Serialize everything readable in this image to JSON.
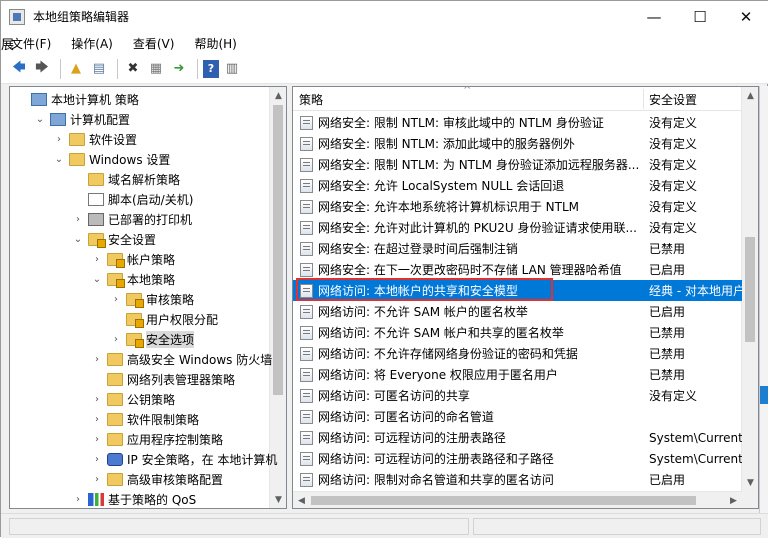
{
  "window": {
    "title": "本地组策略编辑器",
    "controls": {
      "minimize": "—",
      "maximize": "☐",
      "close": "✕"
    },
    "partial_glyph": "展"
  },
  "menu": [
    "文件(F)",
    "操作(A)",
    "查看(V)",
    "帮助(H)"
  ],
  "toolbar": [
    {
      "name": "back-icon",
      "glyph": "🡄"
    },
    {
      "name": "forward-icon",
      "glyph": "🡆"
    },
    {
      "name": "up-folder-icon",
      "glyph": "▲"
    },
    {
      "name": "show-tree-icon",
      "glyph": "▤"
    },
    {
      "name": "delete-icon",
      "glyph": "✖"
    },
    {
      "name": "properties-icon",
      "glyph": "▦"
    },
    {
      "name": "export-icon",
      "glyph": "➜"
    },
    {
      "name": "help-icon",
      "glyph": "?"
    },
    {
      "name": "view-icon",
      "glyph": "▥"
    }
  ],
  "tree": [
    {
      "label": "本地计算机 策略",
      "depth": 0,
      "twisty": "",
      "icon": "computer"
    },
    {
      "label": "计算机配置",
      "depth": 1,
      "twisty": "⌄",
      "icon": "computer"
    },
    {
      "label": "软件设置",
      "depth": 2,
      "twisty": "›",
      "icon": "folder"
    },
    {
      "label": "Windows 设置",
      "depth": 2,
      "twisty": "⌄",
      "icon": "folder"
    },
    {
      "label": "域名解析策略",
      "depth": 3,
      "twisty": "",
      "icon": "folder"
    },
    {
      "label": "脚本(启动/关机)",
      "depth": 3,
      "twisty": "",
      "icon": "doc"
    },
    {
      "label": "已部署的打印机",
      "depth": 3,
      "twisty": "›",
      "icon": "printer"
    },
    {
      "label": "安全设置",
      "depth": 3,
      "twisty": "⌄",
      "icon": "folder-locked"
    },
    {
      "label": "帐户策略",
      "depth": 4,
      "twisty": "›",
      "icon": "folder-locked"
    },
    {
      "label": "本地策略",
      "depth": 4,
      "twisty": "⌄",
      "icon": "folder-locked"
    },
    {
      "label": "审核策略",
      "depth": 5,
      "twisty": "›",
      "icon": "folder-locked"
    },
    {
      "label": "用户权限分配",
      "depth": 5,
      "twisty": "",
      "icon": "folder-locked"
    },
    {
      "label": "安全选项",
      "depth": 5,
      "twisty": "›",
      "icon": "folder-locked",
      "selected": true
    },
    {
      "label": "高级安全 Windows 防火墙",
      "depth": 4,
      "twisty": "›",
      "icon": "folder"
    },
    {
      "label": "网络列表管理器策略",
      "depth": 4,
      "twisty": "",
      "icon": "folder"
    },
    {
      "label": "公钥策略",
      "depth": 4,
      "twisty": "›",
      "icon": "folder"
    },
    {
      "label": "软件限制策略",
      "depth": 4,
      "twisty": "›",
      "icon": "folder"
    },
    {
      "label": "应用程序控制策略",
      "depth": 4,
      "twisty": "›",
      "icon": "folder"
    },
    {
      "label": "IP 安全策略，在 本地计算机",
      "depth": 4,
      "twisty": "›",
      "icon": "shield"
    },
    {
      "label": "高级审核策略配置",
      "depth": 4,
      "twisty": "›",
      "icon": "folder"
    },
    {
      "label": "基于策略的 QoS",
      "depth": 3,
      "twisty": "›",
      "icon": "chart"
    }
  ],
  "list": {
    "headers": {
      "policy": "策略",
      "setting": "安全设置"
    },
    "rows": [
      {
        "policy": "网络安全: 限制 NTLM: 审核此域中的 NTLM 身份验证",
        "setting": "没有定义"
      },
      {
        "policy": "网络安全: 限制 NTLM: 添加此域中的服务器例外",
        "setting": "没有定义"
      },
      {
        "policy": "网络安全: 限制 NTLM: 为 NTLM 身份验证添加远程服务器...",
        "setting": "没有定义"
      },
      {
        "policy": "网络安全: 允许 LocalSystem NULL 会话回退",
        "setting": "没有定义"
      },
      {
        "policy": "网络安全: 允许本地系统将计算机标识用于 NTLM",
        "setting": "没有定义"
      },
      {
        "policy": "网络安全: 允许对此计算机的 PKU2U 身份验证请求使用联...",
        "setting": "没有定义"
      },
      {
        "policy": "网络安全: 在超过登录时间后强制注销",
        "setting": "已禁用"
      },
      {
        "policy": "网络安全: 在下一次更改密码时不存储 LAN 管理器哈希值",
        "setting": "已启用"
      },
      {
        "policy": "网络访问: 本地帐户的共享和安全模型",
        "setting": "经典 - 对本地用户",
        "selected": true
      },
      {
        "policy": "网络访问: 不允许 SAM 帐户的匿名枚举",
        "setting": "已启用"
      },
      {
        "policy": "网络访问: 不允许 SAM 帐户和共享的匿名枚举",
        "setting": "已禁用"
      },
      {
        "policy": "网络访问: 不允许存储网络身份验证的密码和凭据",
        "setting": "已禁用"
      },
      {
        "policy": "网络访问: 将 Everyone 权限应用于匿名用户",
        "setting": "已禁用"
      },
      {
        "policy": "网络访问: 可匿名访问的共享",
        "setting": "没有定义"
      },
      {
        "policy": "网络访问: 可匿名访问的命名管道",
        "setting": ""
      },
      {
        "policy": "网络访问: 可远程访问的注册表路径",
        "setting": "System\\CurrentC"
      },
      {
        "policy": "网络访问: 可远程访问的注册表路径和子路径",
        "setting": "System\\CurrentC"
      },
      {
        "policy": "网络访问: 限制对命名管道和共享的匿名访问",
        "setting": "已启用"
      }
    ]
  }
}
